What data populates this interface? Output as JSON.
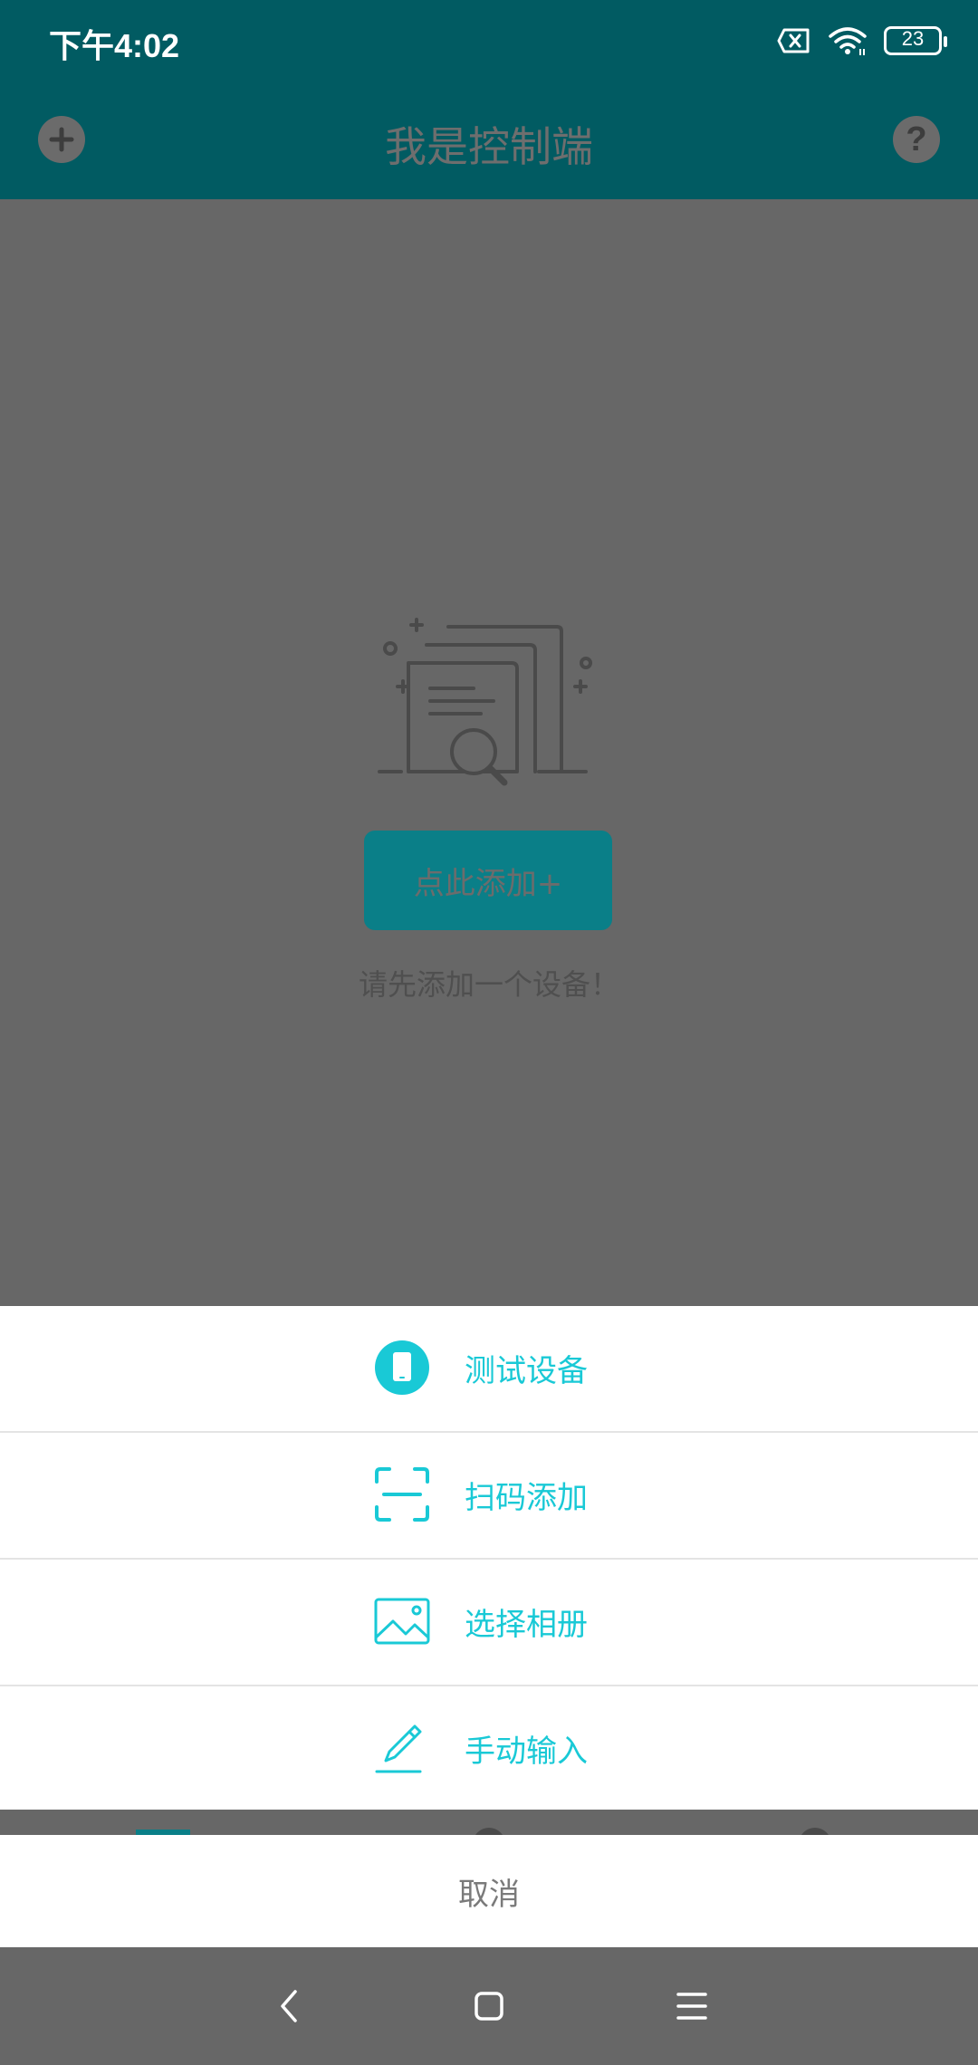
{
  "status_bar": {
    "time": "下午4:02",
    "battery": "23"
  },
  "app_bar": {
    "title": "我是控制端",
    "add_icon": "plus-circle-icon",
    "help_icon": "question-circle-icon"
  },
  "empty_state": {
    "illustration": "document-search-icon",
    "add_button_label": "点此添加+",
    "hint": "请先添加一个设备！"
  },
  "action_sheet": {
    "items": [
      {
        "label": "测试设备",
        "icon": "phone-icon"
      },
      {
        "label": "扫码添加",
        "icon": "scan-icon"
      },
      {
        "label": "选择相册",
        "icon": "image-icon"
      },
      {
        "label": "手动输入",
        "icon": "pencil-icon"
      }
    ],
    "cancel_label": "取消"
  },
  "nav_bar": {
    "back_icon": "back-icon",
    "home_icon": "home-icon",
    "menu_icon": "menu-icon"
  },
  "colors": {
    "header": "#015b62",
    "accent": "#19c9d6",
    "overlay": "#676767"
  }
}
